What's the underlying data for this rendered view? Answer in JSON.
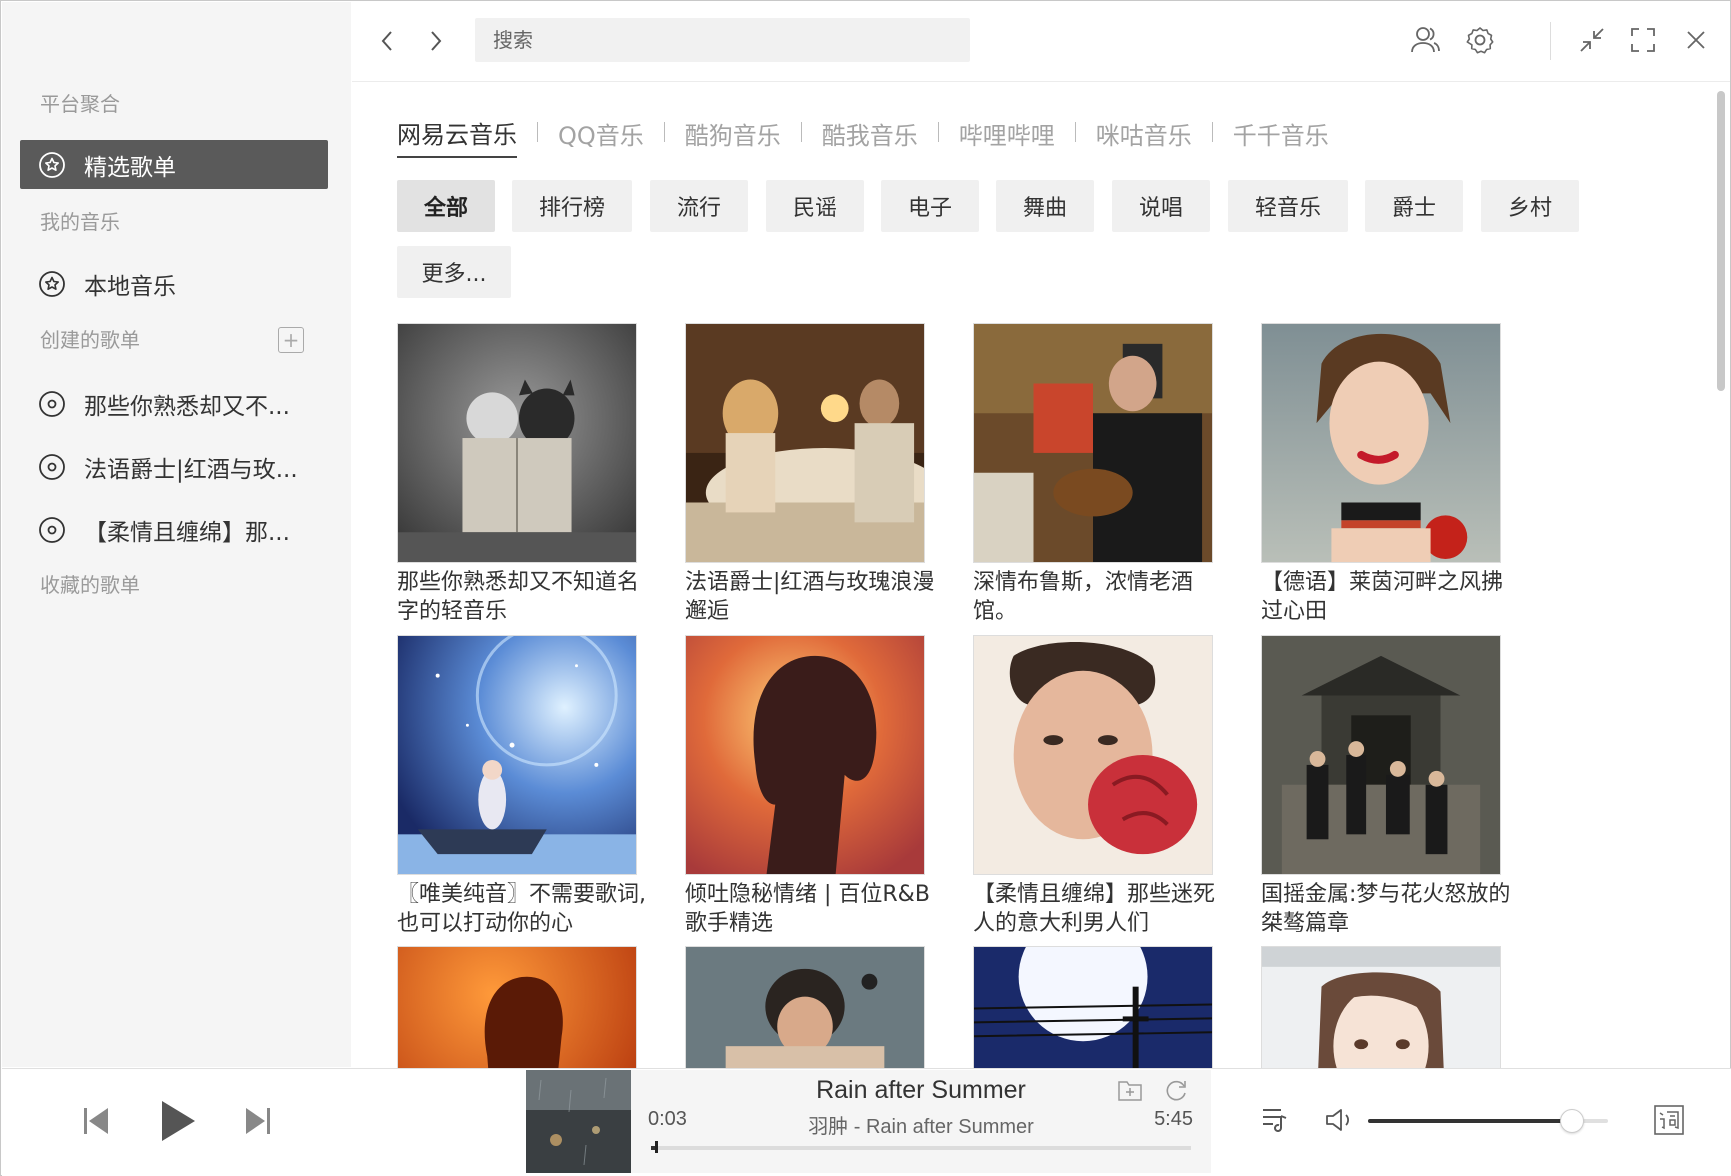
{
  "sidebar": {
    "groups": {
      "platform": "平台聚合",
      "my_music": "我的音乐",
      "created": "创建的歌单",
      "collected": "收藏的歌单"
    },
    "featured": "精选歌单",
    "local": "本地音乐",
    "created_playlists": [
      "那些你熟悉却又不...",
      "法语爵士|红酒与玫...",
      "【柔情且缠绵】那..."
    ]
  },
  "topbar": {
    "search_placeholder": "搜索"
  },
  "platform_tabs": [
    "网易云音乐",
    "QQ音乐",
    "酷狗音乐",
    "酷我音乐",
    "哔哩哔哩",
    "咪咕音乐",
    "千千音乐"
  ],
  "active_platform": "网易云音乐",
  "filters": [
    "全部",
    "排行榜",
    "流行",
    "民谣",
    "电子",
    "舞曲",
    "说唱",
    "轻音乐",
    "爵士",
    "乡村",
    "更多..."
  ],
  "active_filter": "全部",
  "playlists": [
    {
      "title": "那些你熟悉却又不知道名字的轻音乐"
    },
    {
      "title": "法语爵士|红酒与玫瑰浪漫邂逅"
    },
    {
      "title": "深情布鲁斯，浓情老酒馆。"
    },
    {
      "title": "【德语】莱茵河畔之风拂过心田"
    },
    {
      "title": "〖唯美纯音〗不需要歌词,也可以打动你的心"
    },
    {
      "title": "倾吐隐秘情绪 | 百位R&B歌手精选"
    },
    {
      "title": "【柔情且缠绵】那些迷死人的意大利男人们"
    },
    {
      "title": "国摇金属:梦与花火怒放的桀骜篇章"
    },
    {
      "title": ""
    },
    {
      "title": ""
    },
    {
      "title": ""
    },
    {
      "title": ""
    }
  ],
  "player": {
    "title": "Rain after Summer",
    "subtitle": "羽肿 - Rain after Summer",
    "current_time": "0:03",
    "total_time": "5:45",
    "progress_fraction": 0.009,
    "volume_fraction": 0.85
  }
}
